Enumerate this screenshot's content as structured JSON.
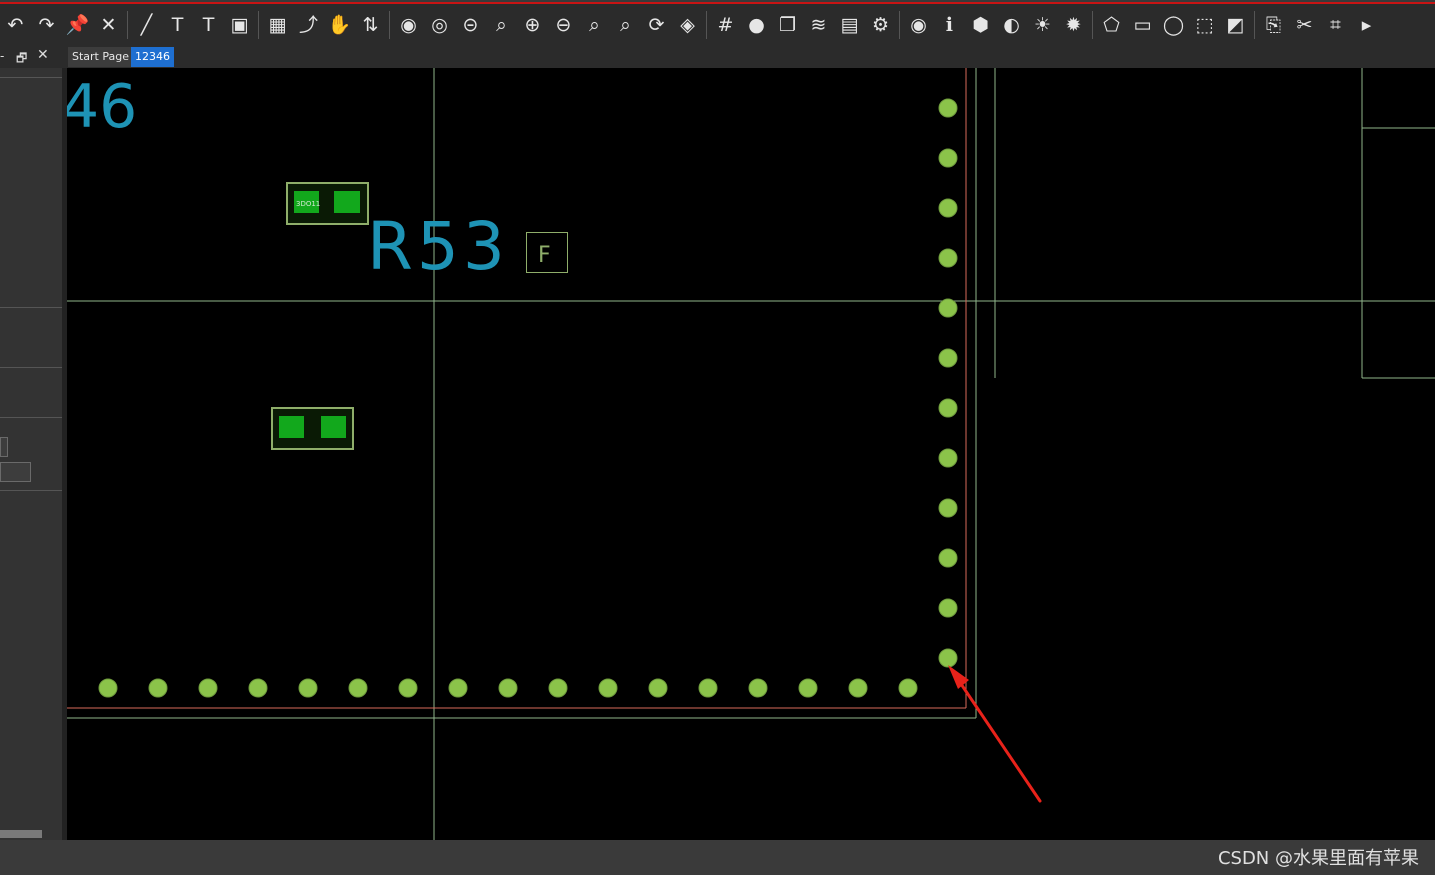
{
  "toolbar": {
    "buttons": [
      {
        "name": "undo-icon",
        "glyph": "↶"
      },
      {
        "name": "redo-icon",
        "glyph": "↷"
      },
      {
        "name": "pin-icon",
        "glyph": "📌"
      },
      {
        "name": "unpin-icon",
        "glyph": "✕"
      },
      {
        "name": "draw-line-icon",
        "glyph": "╱"
      },
      {
        "name": "text-tool-icon",
        "glyph": "T"
      },
      {
        "name": "text-edit-icon",
        "glyph": "T"
      },
      {
        "name": "component-icon",
        "glyph": "▣"
      },
      {
        "name": "chip-icon",
        "glyph": "▦"
      },
      {
        "name": "route-icon",
        "glyph": "⤴"
      },
      {
        "name": "interactive-route-icon",
        "glyph": "✋"
      },
      {
        "name": "diff-pair-icon",
        "glyph": "⇅"
      },
      {
        "name": "drc-icon",
        "glyph": "◉"
      },
      {
        "name": "net-check-icon",
        "glyph": "◎"
      },
      {
        "name": "zoom-fit-icon",
        "glyph": "⊝"
      },
      {
        "name": "zoom-window-icon",
        "glyph": "⌕"
      },
      {
        "name": "zoom-in-icon",
        "glyph": "⊕"
      },
      {
        "name": "zoom-out-icon",
        "glyph": "⊖"
      },
      {
        "name": "zoom-previous-icon",
        "glyph": "⌕"
      },
      {
        "name": "zoom-selection-icon",
        "glyph": "⌕"
      },
      {
        "name": "refresh-icon",
        "glyph": "⟳"
      },
      {
        "name": "board-3d-icon",
        "glyph": "◈"
      },
      {
        "name": "grid-icon",
        "glyph": "#"
      },
      {
        "name": "color-icon",
        "glyph": "●"
      },
      {
        "name": "layer-window-icon",
        "glyph": "❐"
      },
      {
        "name": "layers-icon",
        "glyph": "≋"
      },
      {
        "name": "report-icon",
        "glyph": "▤"
      },
      {
        "name": "settings-doc-icon",
        "glyph": "⚙"
      },
      {
        "name": "visibility-icon",
        "glyph": "◉"
      },
      {
        "name": "properties-icon",
        "glyph": "ℹ"
      },
      {
        "name": "3d-view-icon",
        "glyph": "⬢"
      },
      {
        "name": "shading-icon",
        "glyph": "◐"
      },
      {
        "name": "light-icon",
        "glyph": "☀"
      },
      {
        "name": "highlight-icon",
        "glyph": "✹"
      },
      {
        "name": "add-shape-icon",
        "glyph": "⬠"
      },
      {
        "name": "add-rectangle-icon",
        "glyph": "▭"
      },
      {
        "name": "add-circle-icon",
        "glyph": "◯"
      },
      {
        "name": "select-icon",
        "glyph": "⬚"
      },
      {
        "name": "diagonal-icon",
        "glyph": "◩"
      },
      {
        "name": "copy-tool-icon",
        "glyph": "⎘"
      },
      {
        "name": "cut-tool-icon",
        "glyph": "✂"
      },
      {
        "name": "camera-icon",
        "glyph": "⌗"
      },
      {
        "name": "overflow-icon",
        "glyph": "▸"
      }
    ]
  },
  "tabs": {
    "start": "Start Page",
    "document": "12346"
  },
  "pcb": {
    "label_partial": "46",
    "refdes": "R53",
    "marker": "F",
    "pad_text": "3DO11",
    "colors": {
      "silk_cyan": "#1e93b5",
      "via_green": "#8bc34a",
      "pad_green": "#12a81c",
      "outline_green": "#8fae6a",
      "board_edge_red": "#d96a5a",
      "guide_line": "#8fb68a"
    }
  },
  "watermark": "CSDN @水果里面有苹果"
}
